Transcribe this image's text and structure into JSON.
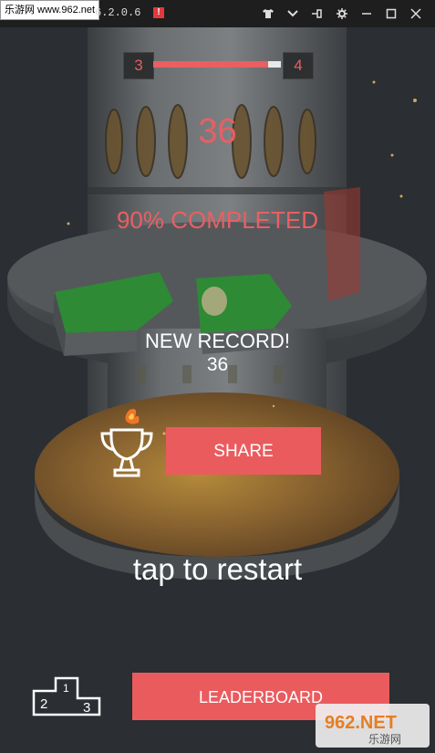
{
  "titlebar": {
    "watermark": "乐游网 www.962.net",
    "app_version": "6.2.0.6",
    "alert_icon": "!",
    "icons": [
      "shirt-icon",
      "chevron-down-icon",
      "pin-icon",
      "gear-icon",
      "minimize-icon",
      "maximize-icon",
      "close-icon"
    ]
  },
  "hud": {
    "current_level": "3",
    "next_level": "4",
    "progress": 0.9,
    "score": "36",
    "completed_text": "90% COMPLETED"
  },
  "result": {
    "record_label": "NEW RECORD!",
    "record_value": "36",
    "share_label": "SHARE",
    "restart_text": "tap to restart",
    "leaderboard_label": "LEADERBOARD"
  },
  "podium": {
    "labels": [
      "1",
      "2",
      "3"
    ]
  },
  "colors": {
    "accent": "#ea5b5e",
    "background": "#2b2e33"
  },
  "watermark_bottom": {
    "logo": "962.NET",
    "site": "乐游网"
  }
}
